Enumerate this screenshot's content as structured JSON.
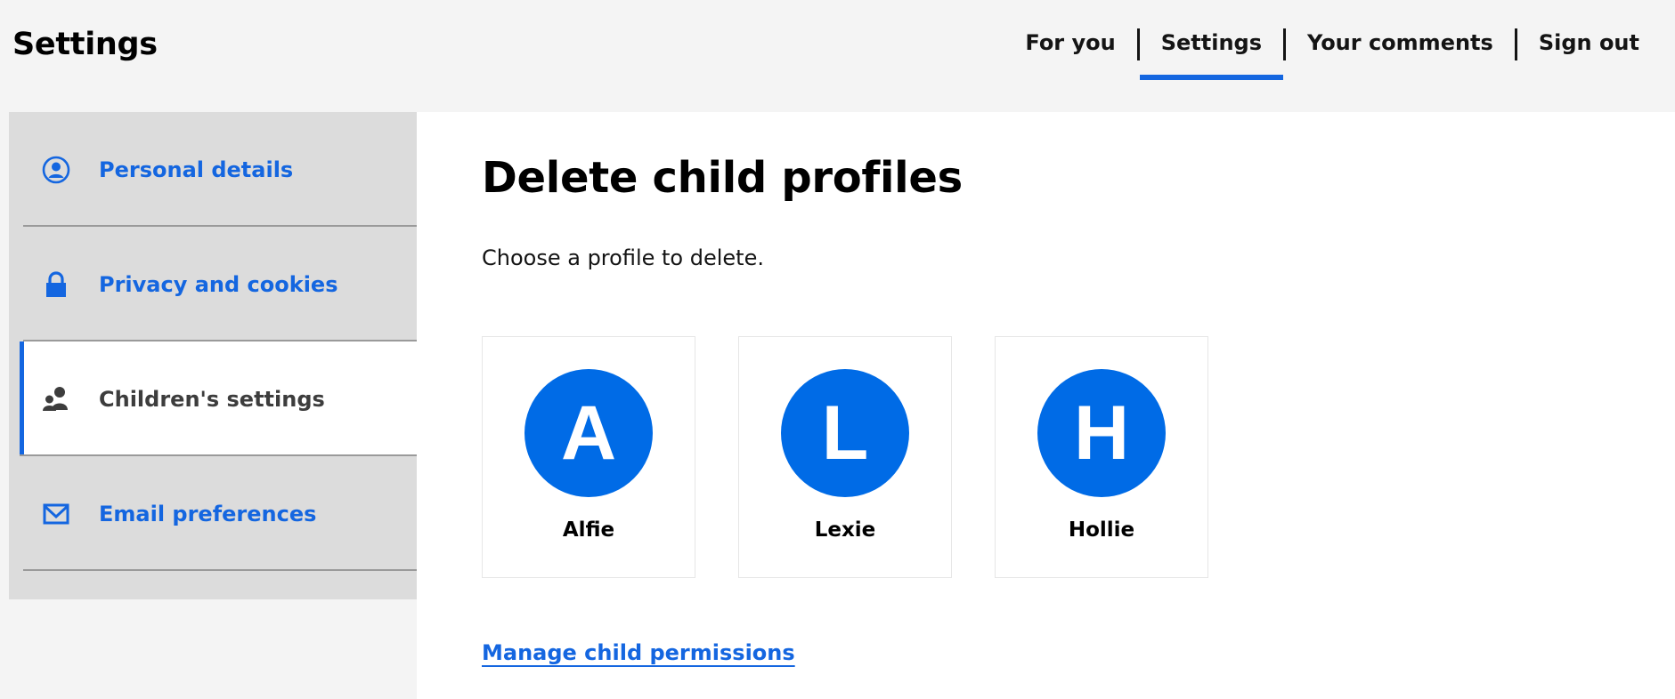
{
  "header": {
    "title": "Settings",
    "nav": [
      {
        "label": "For you",
        "active": false
      },
      {
        "label": "Settings",
        "active": true
      },
      {
        "label": "Your comments",
        "active": false
      },
      {
        "label": "Sign out",
        "active": false
      }
    ]
  },
  "sidebar": {
    "items": [
      {
        "label": "Personal details",
        "icon": "user-circle-icon",
        "active": false
      },
      {
        "label": "Privacy and cookies",
        "icon": "lock-icon",
        "active": false
      },
      {
        "label": "Children's settings",
        "icon": "children-icon",
        "active": true
      },
      {
        "label": "Email preferences",
        "icon": "envelope-icon",
        "active": false
      }
    ]
  },
  "main": {
    "heading": "Delete child profiles",
    "intro": "Choose a profile to delete.",
    "profiles": [
      {
        "initial": "A",
        "name": "Alfie"
      },
      {
        "initial": "L",
        "name": "Lexie"
      },
      {
        "initial": "H",
        "name": "Hollie"
      }
    ],
    "manage_link": "Manage child permissions"
  },
  "colors": {
    "accent": "#1466e0",
    "avatar": "#006be6",
    "page_bg": "#f4f4f4",
    "sidebar_bg": "#dcdcdc"
  }
}
